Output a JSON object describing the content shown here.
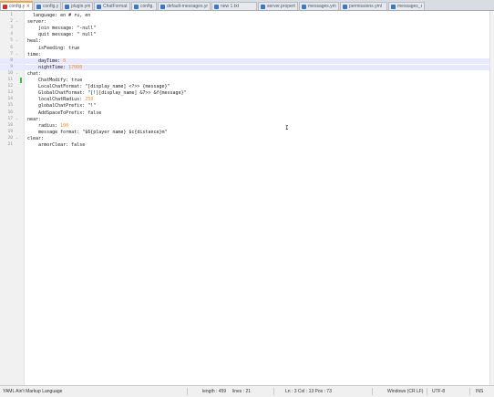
{
  "tabs": [
    {
      "label": "config.yml",
      "active": true
    },
    {
      "label": "config.yml",
      "active": false
    },
    {
      "label": "plugin.yml",
      "active": false
    },
    {
      "label": "ChatFormat.java",
      "active": false
    },
    {
      "label": "config.yml",
      "active": false
    },
    {
      "label": "default-messages.yml",
      "active": false
    },
    {
      "label": "new 1.txt",
      "active": false
    },
    {
      "label": "server.properties",
      "active": false
    },
    {
      "label": "messages.yml",
      "active": false
    },
    {
      "label": "permissions.yml",
      "active": false
    },
    {
      "label": "messages_en.yml",
      "active": false
    }
  ],
  "editor": {
    "lines": [
      {
        "n": "1",
        "fold": "",
        "code": "  language: en # ru, en"
      },
      {
        "n": "2",
        "fold": "-",
        "code": "server:"
      },
      {
        "n": "3",
        "fold": "",
        "code": "    join message: \"-null\""
      },
      {
        "n": "4",
        "fold": "",
        "code": "    quit message: \" null\""
      },
      {
        "n": "5",
        "fold": "-",
        "code": "heal:"
      },
      {
        "n": "6",
        "fold": "",
        "code": "    isFeeding: true"
      },
      {
        "n": "7",
        "fold": "-",
        "code": "time:"
      },
      {
        "n": "8",
        "fold": "",
        "code": "    dayTime: 0"
      },
      {
        "n": "9",
        "fold": "",
        "code": "    nightTime: 17000"
      },
      {
        "n": "10",
        "fold": "-",
        "code": "chat:"
      },
      {
        "n": "11",
        "fold": "",
        "code": "    ChatModify: true"
      },
      {
        "n": "12",
        "fold": "",
        "code": "    LocalChatFormat: \"[display_name] <?>> {message}\""
      },
      {
        "n": "13",
        "fold": "",
        "code": "    GlobalChatFormat: \"[!][display_name] &7>> &f{message}\""
      },
      {
        "n": "14",
        "fold": "",
        "code": "    localChatRadius: 250"
      },
      {
        "n": "15",
        "fold": "",
        "code": "    globalChatPrefix: \"!\""
      },
      {
        "n": "16",
        "fold": "",
        "code": "    AddSpaceToPrefix: false"
      },
      {
        "n": "17",
        "fold": "-",
        "code": "near:"
      },
      {
        "n": "18",
        "fold": "",
        "code": "    radius: 100"
      },
      {
        "n": "19",
        "fold": "",
        "code": "    message format: \"$6{player name} $c{distance}m\""
      },
      {
        "n": "20",
        "fold": "-",
        "code": "clear:"
      },
      {
        "n": "21",
        "fold": "",
        "code": "    armorClear: false"
      }
    ]
  },
  "status": {
    "language": "YAML Ain't Markup Language",
    "length": "length : 459",
    "lines": "lines : 21",
    "position": "Ln : 3   Col : 13   Pos : 73",
    "eol": "Windows (CR LF)",
    "encoding": "UTF-8",
    "mode": "INS"
  },
  "colors": {
    "accent_tab": "#f5a33b",
    "change_marker": "#42b64a",
    "number": "#f28b26"
  }
}
